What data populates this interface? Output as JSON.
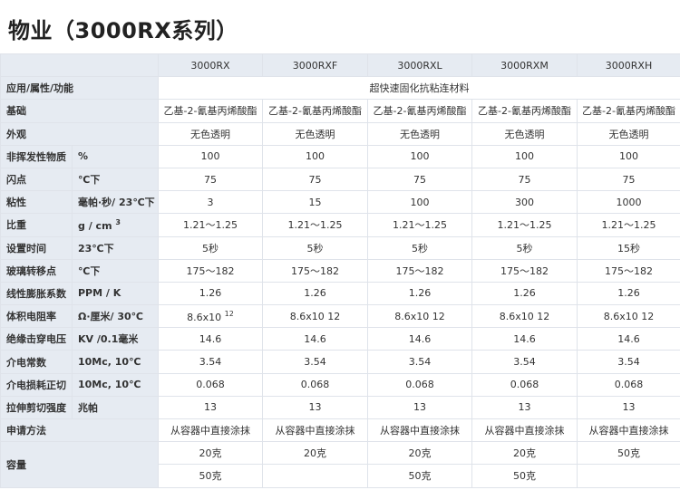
{
  "title": "物业（3000RX系列）",
  "columns": [
    "3000RX",
    "3000RXF",
    "3000RXL",
    "3000RXM",
    "3000RXH"
  ],
  "rows": [
    {
      "label": "应用/属性/功能",
      "unit": "",
      "span_value": "超快速固化抗粘连材料"
    },
    {
      "label": "基础",
      "unit": "",
      "values": [
        "乙基-2-氰基丙烯酸酯",
        "乙基-2-氰基丙烯酸酯",
        "乙基-2-氰基丙烯酸酯",
        "乙基-2-氰基丙烯酸酯",
        "乙基-2-氰基丙烯酸酯"
      ]
    },
    {
      "label": "外观",
      "unit": "",
      "values": [
        "无色透明",
        "无色透明",
        "无色透明",
        "无色透明",
        "无色透明"
      ]
    },
    {
      "label": "非挥发性物质",
      "unit": "%",
      "values": [
        "100",
        "100",
        "100",
        "100",
        "100"
      ]
    },
    {
      "label": "闪点",
      "unit": "℃下",
      "values": [
        "75",
        "75",
        "75",
        "75",
        "75"
      ]
    },
    {
      "label": "粘性",
      "unit": "毫帕·秒/ 23℃下",
      "values": [
        "3",
        "15",
        "100",
        "300",
        "1000"
      ]
    },
    {
      "label": "比重",
      "unit": "g / cm",
      "unit_sup": "3",
      "values": [
        "1.21～1.25",
        "1.21～1.25",
        "1.21～1.25",
        "1.21～1.25",
        "1.21～1.25"
      ]
    },
    {
      "label": "设置时间",
      "unit": "23℃下",
      "values": [
        "5秒",
        "5秒",
        "5秒",
        "5秒",
        "15秒"
      ]
    },
    {
      "label": "玻璃转移点",
      "unit": "℃下",
      "values": [
        "175～182",
        "175～182",
        "175～182",
        "175～182",
        "175～182"
      ]
    },
    {
      "label": "线性膨胀系数",
      "unit": "PPM / K",
      "values": [
        "1.26",
        "1.26",
        "1.26",
        "1.26",
        "1.26"
      ]
    },
    {
      "label": "体积电阻率",
      "unit": "Ω·厘米/ 30℃",
      "values": [
        "8.6x10",
        "8.6x10 12",
        "8.6x10 12",
        "8.6x10 12",
        "8.6x10 12"
      ],
      "first_sup": "12"
    },
    {
      "label": "绝缘击穿电压",
      "unit": "KV /0.1毫米",
      "values": [
        "14.6",
        "14.6",
        "14.6",
        "14.6",
        "14.6"
      ]
    },
    {
      "label": "介电常数",
      "unit": "10Mc, 10℃",
      "values": [
        "3.54",
        "3.54",
        "3.54",
        "3.54",
        "3.54"
      ]
    },
    {
      "label": "介电损耗正切",
      "unit": "10Mc, 10℃",
      "values": [
        "0.068",
        "0.068",
        "0.068",
        "0.068",
        "0.068"
      ]
    },
    {
      "label": "拉伸剪切强度",
      "unit": "兆帕",
      "values": [
        "13",
        "13",
        "13",
        "13",
        "13"
      ]
    },
    {
      "label": "申请方法",
      "unit": "",
      "values": [
        "从容器中直接涂抹",
        "从容器中直接涂抹",
        "从容器中直接涂抹",
        "从容器中直接涂抹",
        "从容器中直接涂抹"
      ]
    }
  ],
  "capacity": {
    "label": "容量",
    "row1": [
      "20克",
      "20克",
      "20克",
      "20克",
      "50克"
    ],
    "row2": [
      "50克",
      "",
      "50克",
      "50克",
      ""
    ]
  }
}
